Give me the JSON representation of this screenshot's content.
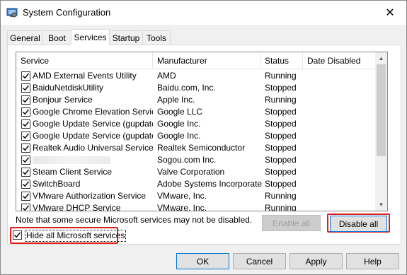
{
  "window": {
    "title": "System Configuration",
    "close_glyph": "✕"
  },
  "tabs": [
    {
      "label": "General"
    },
    {
      "label": "Boot"
    },
    {
      "label": "Services",
      "active": true
    },
    {
      "label": "Startup"
    },
    {
      "label": "Tools"
    }
  ],
  "services": {
    "columns": [
      "Service",
      "Manufacturer",
      "Status",
      "Date Disabled"
    ],
    "rows": [
      {
        "service": "AMD External Events Utility",
        "manufacturer": "AMD",
        "status": "Running",
        "checked": true
      },
      {
        "service": "BaiduNetdiskUtility",
        "manufacturer": "Baidu.com, Inc.",
        "status": "Stopped",
        "checked": true
      },
      {
        "service": "Bonjour Service",
        "manufacturer": "Apple Inc.",
        "status": "Running",
        "checked": true
      },
      {
        "service": "Google Chrome Elevation Servic...",
        "manufacturer": "Google LLC",
        "status": "Stopped",
        "checked": true
      },
      {
        "service": "Google Update Service (gupdate)",
        "manufacturer": "Google Inc.",
        "status": "Stopped",
        "checked": true
      },
      {
        "service": "Google Update Service (gupdatem)",
        "manufacturer": "Google Inc.",
        "status": "Stopped",
        "checked": true
      },
      {
        "service": "Realtek Audio Universal Service",
        "manufacturer": "Realtek Semiconductor",
        "status": "Stopped",
        "checked": true
      },
      {
        "service": "",
        "manufacturer": "Sogou.com Inc.",
        "status": "Stopped",
        "checked": true,
        "obscured": true
      },
      {
        "service": "Steam Client Service",
        "manufacturer": "Valve Corporation",
        "status": "Stopped",
        "checked": true
      },
      {
        "service": "SwitchBoard",
        "manufacturer": "Adobe Systems Incorporated",
        "status": "Stopped",
        "checked": true
      },
      {
        "service": "VMware Authorization Service",
        "manufacturer": "VMware, Inc.",
        "status": "Running",
        "checked": true
      },
      {
        "service": "VMware DHCP Service",
        "manufacturer": "VMware, Inc.",
        "status": "Running",
        "checked": true
      }
    ]
  },
  "note": "Note that some secure Microsoft services may not be disabled.",
  "hide_ms": {
    "label": "Hide all Microsoft services",
    "checked": true
  },
  "buttons": {
    "enable_all": "Enable all",
    "disable_all": "Disable all",
    "ok": "OK",
    "cancel": "Cancel",
    "apply": "Apply",
    "help": "Help"
  },
  "colors": {
    "highlight": "#e0201b",
    "accent": "#0078d7"
  },
  "icons": {
    "title": "system-config-icon",
    "check": "checkmark-icon"
  }
}
